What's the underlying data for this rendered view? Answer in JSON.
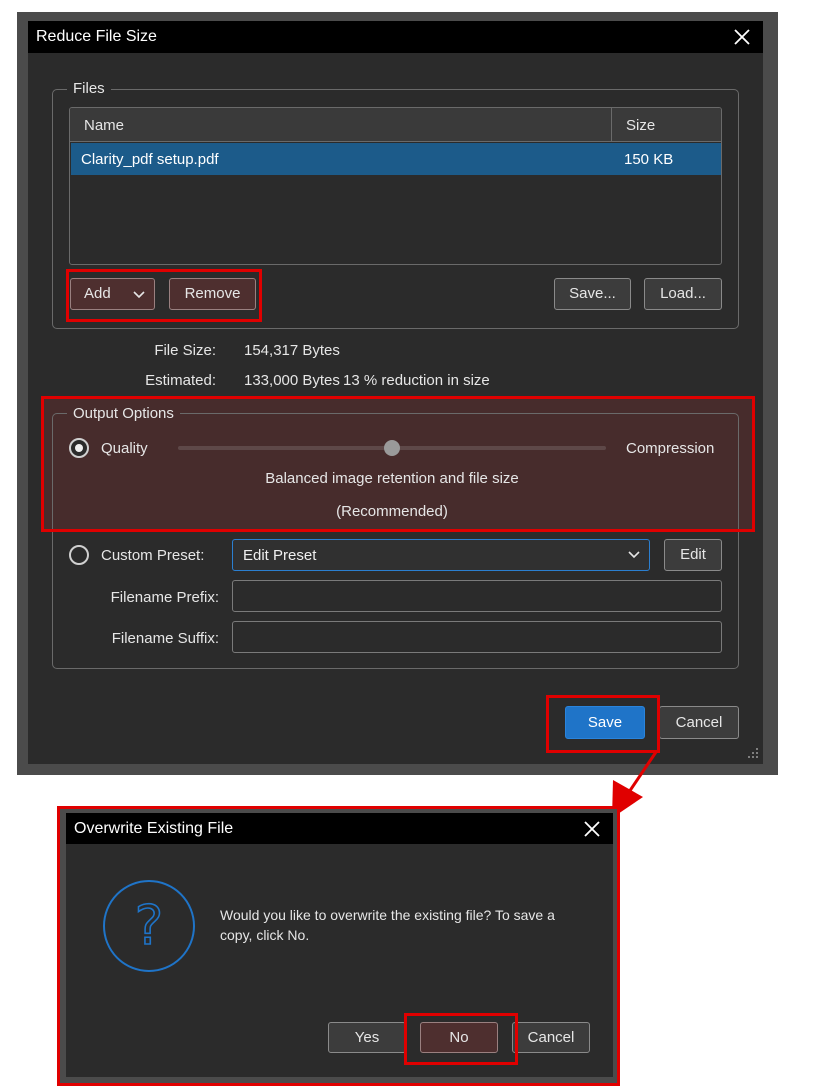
{
  "main_dialog": {
    "title": "Reduce File Size",
    "files_group_label": "Files",
    "columns": {
      "name": "Name",
      "size": "Size"
    },
    "files": [
      {
        "name": "Clarity_pdf setup.pdf",
        "size": "150 KB"
      }
    ],
    "buttons": {
      "add": "Add",
      "remove": "Remove",
      "save_list": "Save...",
      "load_list": "Load..."
    },
    "file_size_label": "File Size:",
    "file_size_value": "154,317 Bytes",
    "estimated_label": "Estimated:",
    "estimated_value": "133,000 Bytes",
    "reduction_text": "13 % reduction in size",
    "output_group_label": "Output Options",
    "quality_label": "Quality",
    "compression_label": "Compression",
    "slider_level": 0.5,
    "slider_desc_1": "Balanced image retention and file size",
    "slider_desc_2": "(Recommended)",
    "custom_preset_label": "Custom Preset:",
    "preset_value": "Edit Preset",
    "edit_button": "Edit",
    "prefix_label": "Filename Prefix:",
    "suffix_label": "Filename Suffix:",
    "prefix_value": "",
    "suffix_value": "",
    "save_button": "Save",
    "cancel_button": "Cancel"
  },
  "overwrite_dialog": {
    "title": "Overwrite Existing File",
    "message": "Would you like to overwrite the existing file? To save a copy, click No.",
    "yes_button": "Yes",
    "no_button": "No",
    "cancel_button": "Cancel"
  },
  "colors": {
    "highlight_red": "#e00000",
    "selection_blue": "#1c5b8a",
    "primary_blue": "#1f74c8",
    "dialog_bg": "#2b2b2b"
  }
}
